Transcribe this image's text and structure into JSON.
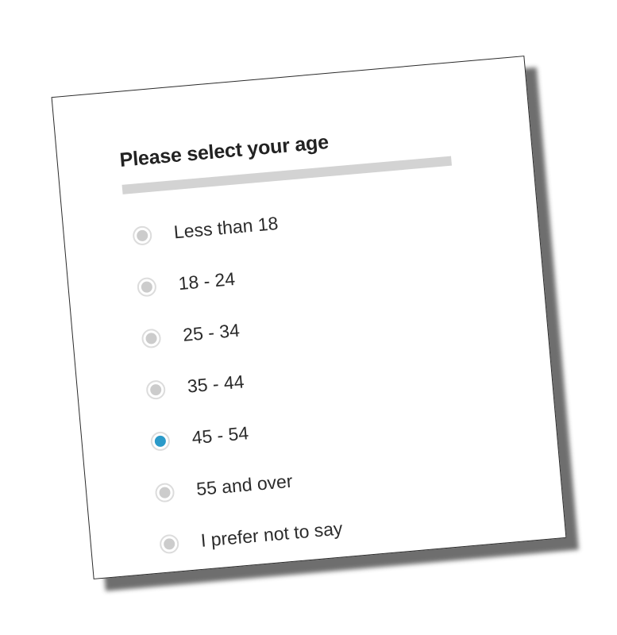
{
  "survey": {
    "question": "Please select your age",
    "selected_color": "#2b9ac9",
    "unselected_color": "#cccccc",
    "options": [
      {
        "label": "Less than 18",
        "selected": false
      },
      {
        "label": "18 - 24",
        "selected": false
      },
      {
        "label": "25 - 34",
        "selected": false
      },
      {
        "label": "35 - 44",
        "selected": false
      },
      {
        "label": "45 - 54",
        "selected": true
      },
      {
        "label": "55 and over",
        "selected": false
      },
      {
        "label": "I prefer not to say",
        "selected": false
      }
    ]
  }
}
